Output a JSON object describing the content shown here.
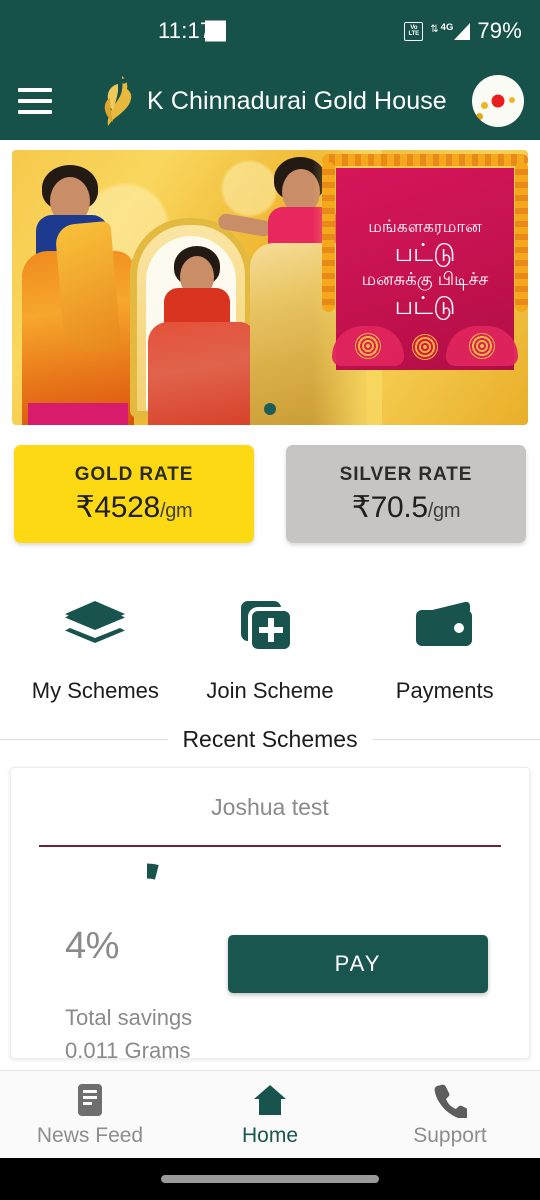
{
  "status_bar": {
    "time": "11:17",
    "volte_top": "VoLTE",
    "volte_line1": "Vo",
    "volte_line2": "LTE",
    "network": "4G",
    "battery": "79%"
  },
  "app_bar": {
    "menu_icon": "hamburger-menu-icon",
    "logo_icon": "peacock-feather-logo",
    "title": "K Chinnadurai Gold House",
    "avatar_icon": "user-avatar"
  },
  "banner": {
    "alt": "Three women in silk sarees promotional banner",
    "sign_line1": "மங்களகரமான",
    "sign_line2": "பட்டு",
    "sign_line3": "மனசுக்கு பிடிச்ச",
    "sign_line4": "பட்டு",
    "dot_count": 1,
    "active_dot": 0
  },
  "rates": {
    "gold": {
      "label": "GOLD RATE",
      "amount": "₹4528",
      "unit": "/gm",
      "color": "#FCD913"
    },
    "silver": {
      "label": "SILVER RATE",
      "amount": "₹70.5",
      "unit": "/gm",
      "color": "#C6C5C3"
    }
  },
  "actions": [
    {
      "label": "My Schemes",
      "icon": "layers-stack-icon"
    },
    {
      "label": "Join Scheme",
      "icon": "add-card-icon"
    },
    {
      "label": "Payments",
      "icon": "wallet-icon"
    }
  ],
  "recent_section": {
    "title": "Recent Schemes"
  },
  "scheme_card": {
    "name": "Joshua test",
    "progress_pct": "4%",
    "progress_value": 4,
    "pay_label": "PAY",
    "savings_label": "Total savings",
    "savings_value": "0.011 Grams"
  },
  "bottom_nav": [
    {
      "label": "News Feed",
      "icon": "news-feed-icon",
      "active": false
    },
    {
      "label": "Home",
      "icon": "home-icon",
      "active": true
    },
    {
      "label": "Support",
      "icon": "phone-support-icon",
      "active": false
    }
  ],
  "theme": {
    "primary": "#16514A",
    "accent_gold": "#FCD913",
    "accent_silver": "#C6C5C3",
    "pay_button": "#1A5650",
    "rule": "#6E2234"
  }
}
